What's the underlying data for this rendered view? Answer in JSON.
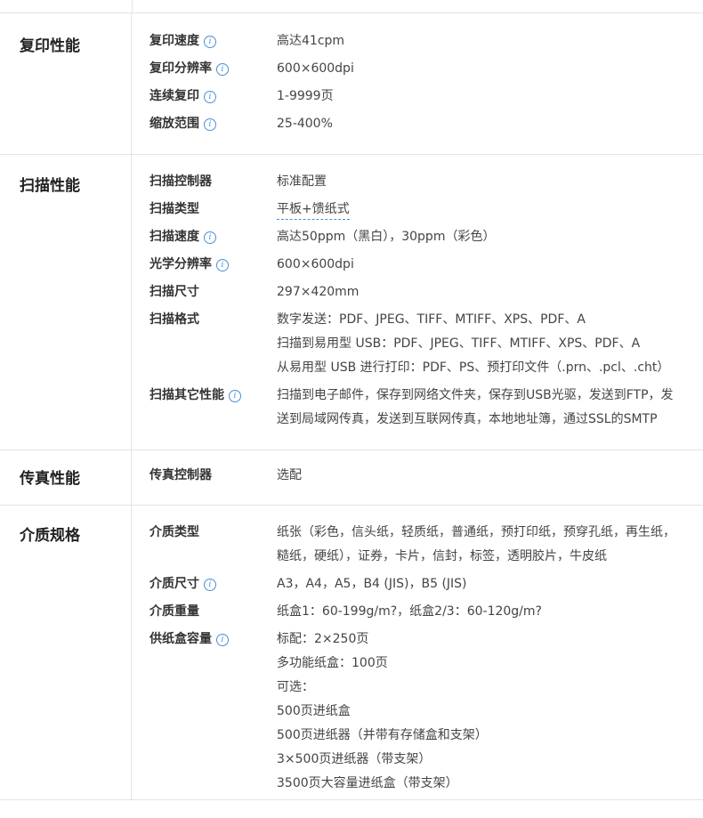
{
  "sections": [
    {
      "title": "复印性能",
      "rows": [
        {
          "label": "复印速度",
          "info": true,
          "values": [
            "高达41cpm"
          ]
        },
        {
          "label": "复印分辨率",
          "info": true,
          "values": [
            "600×600dpi"
          ]
        },
        {
          "label": "连续复印",
          "info": true,
          "values": [
            "1-9999页"
          ]
        },
        {
          "label": "缩放范围",
          "info": true,
          "values": [
            "25-400%"
          ]
        }
      ]
    },
    {
      "title": "扫描性能",
      "rows": [
        {
          "label": "扫描控制器",
          "info": false,
          "values": [
            "标准配置"
          ]
        },
        {
          "label": "扫描类型",
          "info": false,
          "dotted": true,
          "values": [
            "平板+馈纸式"
          ]
        },
        {
          "label": "扫描速度",
          "info": true,
          "values": [
            "高达50ppm（黑白），30ppm（彩色）"
          ]
        },
        {
          "label": "光学分辨率",
          "info": true,
          "values": [
            "600×600dpi"
          ]
        },
        {
          "label": "扫描尺寸",
          "info": false,
          "values": [
            "297×420mm"
          ]
        },
        {
          "label": "扫描格式",
          "info": false,
          "values": [
            "数字发送：PDF、JPEG、TIFF、MTIFF、XPS、PDF、A",
            "扫描到易用型 USB：PDF、JPEG、TIFF、MTIFF、XPS、PDF、A",
            "从易用型 USB 进行打印：PDF、PS、预打印文件（.prn、.pcl、.cht）"
          ]
        },
        {
          "label": "扫描其它性能",
          "info": true,
          "values": [
            "扫描到电子邮件，保存到网络文件夹，保存到USB光驱，发送到FTP，发送到局域网传真，发送到互联网传真，本地地址簿，通过SSL的SMTP"
          ]
        }
      ]
    },
    {
      "title": "传真性能",
      "rows": [
        {
          "label": "传真控制器",
          "info": false,
          "values": [
            "选配"
          ]
        }
      ]
    },
    {
      "title": "介质规格",
      "rows": [
        {
          "label": "介质类型",
          "info": false,
          "values": [
            "纸张（彩色，信头纸，轻质纸，普通纸，预打印纸，预穿孔纸，再生纸，糙纸，硬纸），证券，卡片，信封，标签，透明胶片，牛皮纸"
          ]
        },
        {
          "label": "介质尺寸",
          "info": true,
          "values": [
            "A3，A4，A5，B4 (JIS)，B5 (JIS)"
          ]
        },
        {
          "label": "介质重量",
          "info": false,
          "values": [
            "纸盒1：60-199g/m?，纸盒2/3：60-120g/m?"
          ]
        },
        {
          "label": "供纸盒容量",
          "info": true,
          "values": [
            "标配：2×250页",
            "多功能纸盒：100页",
            "可选：",
            "500页进纸盒",
            "500页进纸器（并带有存储盒和支架）",
            "3×500页进纸器（带支架）",
            "3500页大容量进纸盒（带支架）"
          ]
        }
      ]
    }
  ],
  "icons": {
    "info": "info-icon",
    "info_color": "#4a8fd8"
  }
}
